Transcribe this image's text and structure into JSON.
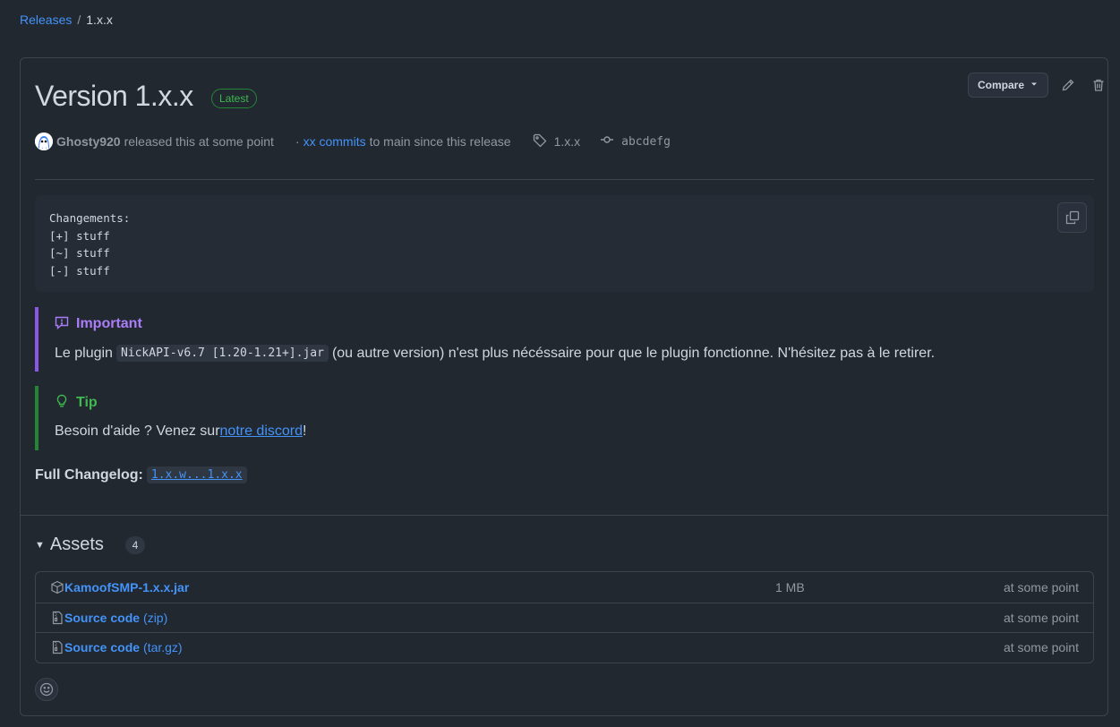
{
  "breadcrumb": {
    "parent": "Releases",
    "separator": "/",
    "current": "1.x.x"
  },
  "release": {
    "title": "Version 1.x.x",
    "latest_badge": "Latest",
    "compare_label": "Compare",
    "author": "Ghosty920",
    "released_text": "released this at some point",
    "dot": "·",
    "commits_link": "xx commits",
    "commits_text": "to main since this release",
    "tag": "1.x.x",
    "commit_sha": "abcdefg"
  },
  "body": {
    "code_lines": "Changements:\n[+] stuff\n[~] stuff\n[-] stuff",
    "important": {
      "title": "Important",
      "text_before": "Le plugin",
      "code": "NickAPI-v6.7 [1.20-1.21+].jar",
      "text_after": "(ou autre version) n'est plus nécéssaire pour que le plugin fonctionne. N'hésitez pas à le retirer."
    },
    "tip": {
      "title": "Tip",
      "text_before": "Besoin d'aide ? Venez sur",
      "link": "notre discord",
      "text_after": "!"
    },
    "changelog": {
      "label": "Full Changelog:",
      "link": "1.x.w...1.x.x"
    }
  },
  "assets": {
    "title": "Assets",
    "count": "4",
    "items": [
      {
        "name": "KamoofSMP-1.x.x.jar",
        "ext": "",
        "size": "1 MB",
        "time": "at some point"
      },
      {
        "name": "Source code",
        "ext": "(zip)",
        "size": "",
        "time": "at some point"
      },
      {
        "name": "Source code",
        "ext": "(tar.gz)",
        "size": "",
        "time": "at some point"
      }
    ]
  },
  "colors": {
    "background": "#212830",
    "accent": "#4493f8",
    "important": "#8957e5",
    "tip": "#238636"
  }
}
